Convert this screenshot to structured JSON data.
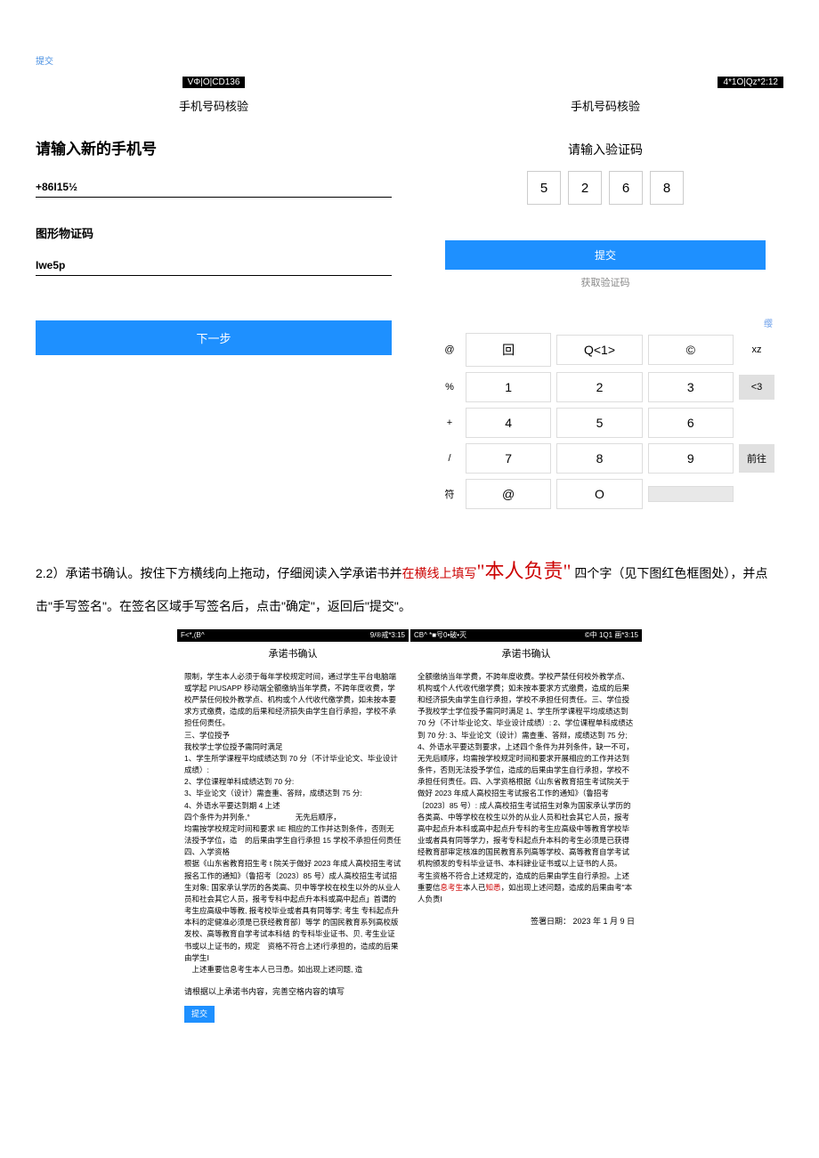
{
  "topSubmit": "提交",
  "leftScreen": {
    "statusBar": "VΦ|O|CD136",
    "title": "手机号码核验",
    "newPhoneLabel": "请输入新的手机号",
    "phoneValue": "+86I15½",
    "captchaLabel": "图形物证码",
    "captchaValue": "Iwe5p",
    "nextBtn": "下一步"
  },
  "rightScreen": {
    "statusBar": "4*1O|Qz*2:12",
    "title": "手机号码核验",
    "codeLabel": "请输入验证码",
    "codeDigits": [
      "5",
      "2",
      "6",
      "8"
    ],
    "submitBtn": "提交",
    "getCode": "获取验证码",
    "toprowHint": "缨",
    "keypad": {
      "symCol": [
        "@",
        "%",
        "+",
        "/",
        "符"
      ],
      "row0": [
        "回",
        "Q<1>",
        "©"
      ],
      "row0Action": "xz",
      "row1": [
        "1",
        "2",
        "3"
      ],
      "row1Action": "<3",
      "row2": [
        "4",
        "5",
        "6"
      ],
      "row3": [
        "7",
        "8",
        "9"
      ],
      "row3Action": "前往",
      "row4": [
        "@",
        "O",
        ""
      ]
    }
  },
  "instruction": {
    "prefix": "2.2）承诺书确认。按住下方横线向上拖动，仔细阅读入学承诺书并",
    "redPart": "在横线上填写",
    "emphasis": "\"本人负责\"",
    "suffix1": " 四个字（见下图红色框图处），并点击\"手写签名\"。在签名区域手写签名后，点击\"确定\"，返回后\"提交\"。"
  },
  "doc1": {
    "statusLeft": "F<*,(B^",
    "statusRight": "9/®戒*3:15",
    "title": "承诺书确认",
    "body": "限制，学生本人必须于每年学校规定时间，通过学生平台电脑端或学起 PIUSAPP 移动端全额缴纳当年学费，不跨年度收费，学校严禁任何校外教学点、机构或个人代收代缴学费，如未按本要求方式缴费，造成的后果和经济损失由学生自行承担，学校不承担任何责任。\n三、学位授予\n我校学士学位授予需同时满足\n1、学生所学课程平均成绩达到 70 分（不计毕业论文、毕业设计成绩）:\n2、学位课程单科成绩达到 70 分:\n3、毕业论文（设计）需查重、答辩，成绩达到 75 分:\n4、外语水平要达到期 4 上述\n四个条件为并列条,°　　　　　　无先后顺序，\n均需按学校规定时间和要求 IiE 相应的工作并达到条件，否则无法授予学位，造　的后果由学生自行承担 15 学校不承担任何责任\n四、入学资格\n根据《山东省教育招生考 t 院关于做好 2023 年成人高校招生考试报名工作的通知》（鲁招考〔2023〕85 号）成人高校招生考试招生对象; 国家承认学历的各类高、贝中等学校在校生以外的从业人员和社会其它人员，报考专科中起点升本科或高中起点」首谓的考生应高级中等教, 报考校毕业或者具有同等学; 考生 专科起点升本科的定健准必须是已获经教育部〕等学 的国民教育系列高校版发校、高等教育自学考试本科结 的专科毕业证书、贝, 考生业证书或以上证书的，规定　资格不符合上述Ⅰ行承担的，造成的后果由学生Ⅰ\n　上述重要信息考生本人已⺕恿。如出现上述问题, 造",
    "footer": "请根据以上承诺书内容，完善空格内容的填写",
    "submitBtn": "提交"
  },
  "doc2": {
    "statusLeft": "CB^ *■号0•破•灭",
    "statusRight": "©中 1Q1 画*3:15",
    "title": "承诺书确认",
    "body": "全额缴纳当年学费，不跨年度收费。学校严禁任何校外教学点、机构或个人代收代缴学费；如未按本要求方式缴费，造成的后果和经济损失由学生自行承担，学校不承担任何责任。三、学位授予我校学士学位授予需同时满足 1、学生所学课程平均成绩达到 70 分（不计毕业论文、毕业设计成绩）: 2、学位课程单科成绩达到 70 分: 3、毕业论文（设计）需查重、答辩，成绩达到 75 分; 4、外语水平要达到要求，上述四个条件为并列条件，缺一不可，无先后顺序，均需按学校规定时间和要求开展相应的工作并达到条件，否则无法授予学位，造成的后果由学生自行承担，学校不承担任何责任。四、入学资格根据《山东省教育招生考试院关于做好 2023 年成人高校招生考试报名工作的通知》（鲁招考〔2023〕85 号）: 成人高校招生考试招生对象为国家承认学历的各类高、中等学校在校生以外的从业人员和社会其它人员，报考高中起点升本科或高中起点升专科的考生应高级中等教育学校毕业或者具有同等学力，报考专科起点升本科的考生必须是已获得经教育部审定核准的国民教育系列高等学校、高等教育自学考试机构颁发的专科毕业证书、本科肄业证书或以上证书的人员。\n考生资格不符合上述规定的，造成的后果由学生自行承担。上述重要信息考生本人已知悉，如出现上述问题，造成的后果由考\"本人负责I",
    "redWords": [
      "息考生",
      "知悉"
    ],
    "signDate": "签署日期： 2023 年 1 月 9 日"
  }
}
